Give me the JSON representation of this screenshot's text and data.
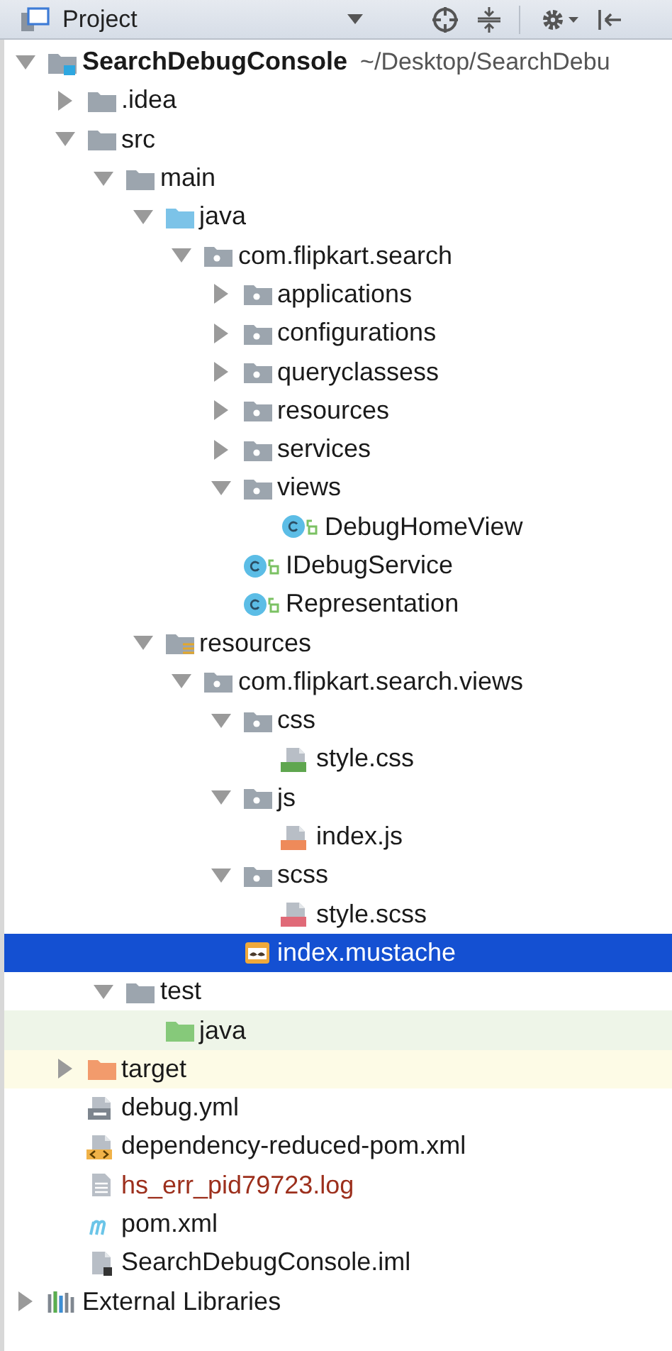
{
  "header": {
    "title": "Project"
  },
  "tree": [
    {
      "label": "SearchDebugConsole",
      "path": "~/Desktop/SearchDebu",
      "kind": "module",
      "expanded": true,
      "selected": false,
      "children": [
        {
          "label": ".idea",
          "kind": "folder",
          "expanded": false,
          "selected": false
        },
        {
          "label": "src",
          "kind": "folder",
          "expanded": true,
          "selected": false,
          "children": [
            {
              "label": "main",
              "kind": "folder",
              "expanded": true,
              "selected": false,
              "children": [
                {
                  "label": "java",
                  "kind": "source",
                  "expanded": true,
                  "selected": false,
                  "children": [
                    {
                      "label": "com.flipkart.search",
                      "kind": "package",
                      "expanded": true,
                      "selected": false,
                      "children": [
                        {
                          "label": "applications",
                          "kind": "package",
                          "expanded": false,
                          "selected": false
                        },
                        {
                          "label": "configurations",
                          "kind": "package",
                          "expanded": false,
                          "selected": false
                        },
                        {
                          "label": "queryclassess",
                          "kind": "package",
                          "expanded": false,
                          "selected": false
                        },
                        {
                          "label": "resources",
                          "kind": "package",
                          "expanded": false,
                          "selected": false
                        },
                        {
                          "label": "services",
                          "kind": "package",
                          "expanded": false,
                          "selected": false
                        },
                        {
                          "label": "views",
                          "kind": "package",
                          "expanded": true,
                          "selected": false,
                          "children": [
                            {
                              "label": "DebugHomeView",
                              "kind": "class",
                              "selected": false
                            }
                          ]
                        },
                        {
                          "label": "IDebugService",
                          "kind": "class",
                          "selected": false
                        },
                        {
                          "label": "Representation",
                          "kind": "class",
                          "selected": false
                        }
                      ]
                    }
                  ]
                },
                {
                  "label": "resources",
                  "kind": "resources",
                  "expanded": true,
                  "selected": false,
                  "children": [
                    {
                      "label": "com.flipkart.search.views",
                      "kind": "package",
                      "expanded": true,
                      "selected": false,
                      "children": [
                        {
                          "label": "css",
                          "kind": "package",
                          "expanded": true,
                          "selected": false,
                          "children": [
                            {
                              "label": "style.css",
                              "kind": "css",
                              "selected": false
                            }
                          ]
                        },
                        {
                          "label": "js",
                          "kind": "package",
                          "expanded": true,
                          "selected": false,
                          "children": [
                            {
                              "label": "index.js",
                              "kind": "js",
                              "selected": false
                            }
                          ]
                        },
                        {
                          "label": "scss",
                          "kind": "package",
                          "expanded": true,
                          "selected": false,
                          "children": [
                            {
                              "label": "style.scss",
                              "kind": "sass",
                              "selected": false
                            }
                          ]
                        },
                        {
                          "label": "index.mustache",
                          "kind": "mustache",
                          "selected": true
                        }
                      ]
                    }
                  ]
                }
              ]
            },
            {
              "label": "test",
              "kind": "folder",
              "expanded": true,
              "selected": false,
              "children": [
                {
                  "label": "java",
                  "kind": "test",
                  "selected": false,
                  "color": "#eef5e8"
                }
              ]
            }
          ]
        },
        {
          "label": "target",
          "kind": "excluded",
          "expanded": false,
          "selected": false,
          "color": "#fdfbe6"
        },
        {
          "label": "debug.yml",
          "kind": "yml",
          "selected": false
        },
        {
          "label": "dependency-reduced-pom.xml",
          "kind": "xml",
          "selected": false
        },
        {
          "label": "hs_err_pid79723.log",
          "kind": "log",
          "selected": false,
          "color": "#9c2f1c"
        },
        {
          "label": "pom.xml",
          "kind": "maven",
          "selected": false
        },
        {
          "label": "SearchDebugConsole.iml",
          "kind": "iml",
          "selected": false
        }
      ]
    },
    {
      "label": "External Libraries",
      "kind": "libraries",
      "expanded": false,
      "selected": false
    }
  ]
}
